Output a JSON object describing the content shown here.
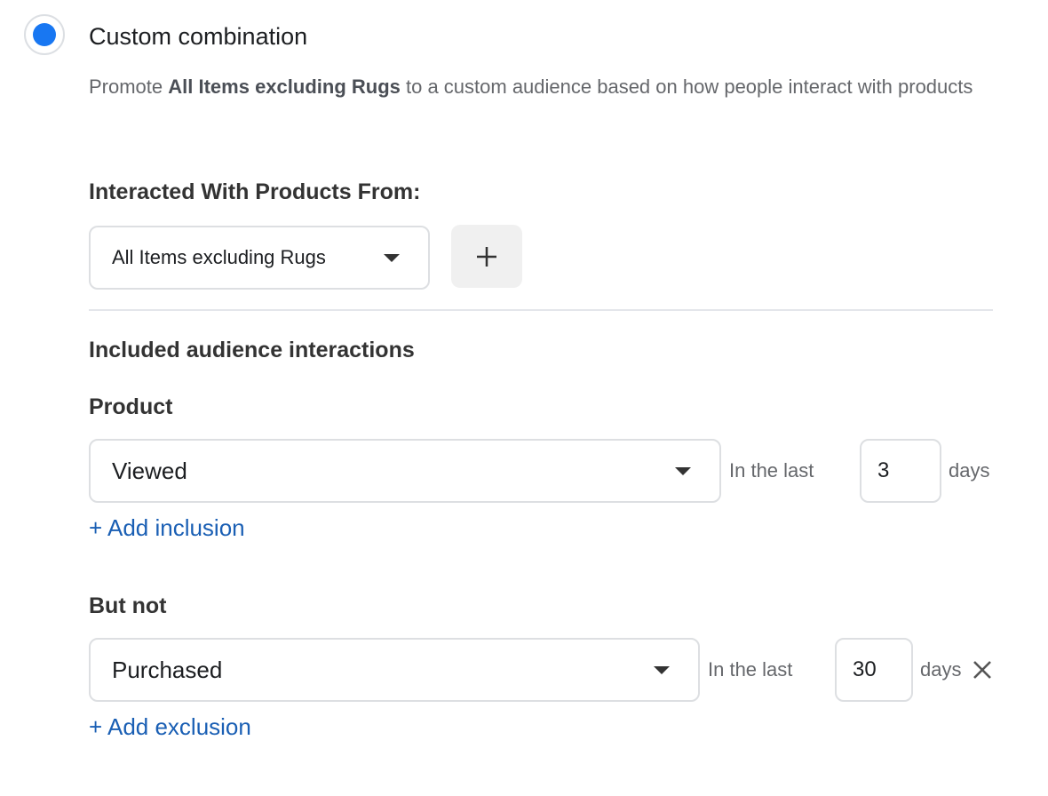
{
  "option": {
    "label": "Custom combination",
    "selected": true,
    "accent_color": "#1877f2"
  },
  "description": {
    "prefix": "Promote ",
    "bold": "All Items excluding Rugs",
    "suffix": " to a custom audience based on how people interact with products"
  },
  "interacted": {
    "heading": "Interacted With Products From:",
    "selected_value": "All Items excluding Rugs",
    "add_icon": "plus-icon"
  },
  "included": {
    "heading": "Included audience interactions",
    "product_heading": "Product",
    "event_value": "Viewed",
    "in_the_last_label": "In the last",
    "days_value": "3",
    "days_label": "days",
    "add_link": "+ Add inclusion"
  },
  "excluded": {
    "heading": "But not",
    "event_value": "Purchased",
    "in_the_last_label": "In the last",
    "days_value": "30",
    "days_label": "days",
    "add_link": "+ Add exclusion",
    "remove_icon": "close-icon"
  },
  "colors": {
    "link": "#1a5fb4",
    "muted_text": "#65676b"
  }
}
